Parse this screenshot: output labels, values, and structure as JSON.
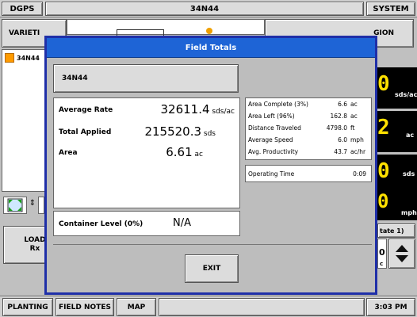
{
  "topbar": {
    "left_btn": "DGPS",
    "title": "34N44",
    "right_btn": "SYSTEM"
  },
  "background": {
    "variety_header": "VARIETI",
    "variety_item": "34N44",
    "region_header": "GION",
    "gauge_units": [
      "sds/ac",
      "ac",
      "sds",
      "mph"
    ],
    "gauge_digits": [
      "0",
      "2",
      "0",
      "0"
    ],
    "load_rx": "LOAD\nRx",
    "rate_label": "tate 1)",
    "rate_digit": "0",
    "rate_unit": "c",
    "swatch_color": "#ff9b00"
  },
  "modal": {
    "title": "Field Totals",
    "variety_button": "34N44",
    "left_stats": [
      {
        "label": "Average Rate",
        "value": "32611.4",
        "unit": "sds/ac"
      },
      {
        "label": "Total Applied",
        "value": "215520.3",
        "unit": "sds"
      },
      {
        "label": "Area",
        "value": "6.61",
        "unit": "ac"
      }
    ],
    "right_stats": [
      {
        "label": "Area Complete (3%)",
        "value": "6.6",
        "unit": "ac"
      },
      {
        "label": "Area Left (96%)",
        "value": "162.8",
        "unit": "ac"
      },
      {
        "label": "Distance Traveled",
        "value": "4798.0",
        "unit": "ft"
      },
      {
        "label": "Average Speed",
        "value": "6.0",
        "unit": "mph"
      },
      {
        "label": "Avg. Productivity",
        "value": "43.7",
        "unit": "ac/hr"
      }
    ],
    "operating_time_label": "Operating Time",
    "operating_time_value": "0:09",
    "container_label": "Container Level (0%)",
    "container_value": "N/A",
    "exit_label": "EXIT"
  },
  "bottombar": {
    "tabs": [
      "PLANTING",
      "FIELD NOTES",
      "MAP"
    ],
    "time": "3:03 PM"
  },
  "colors": {
    "title_blue": "#1e64d6",
    "border_blue": "#1f2fa8",
    "seg_yellow": "#ffe000"
  }
}
